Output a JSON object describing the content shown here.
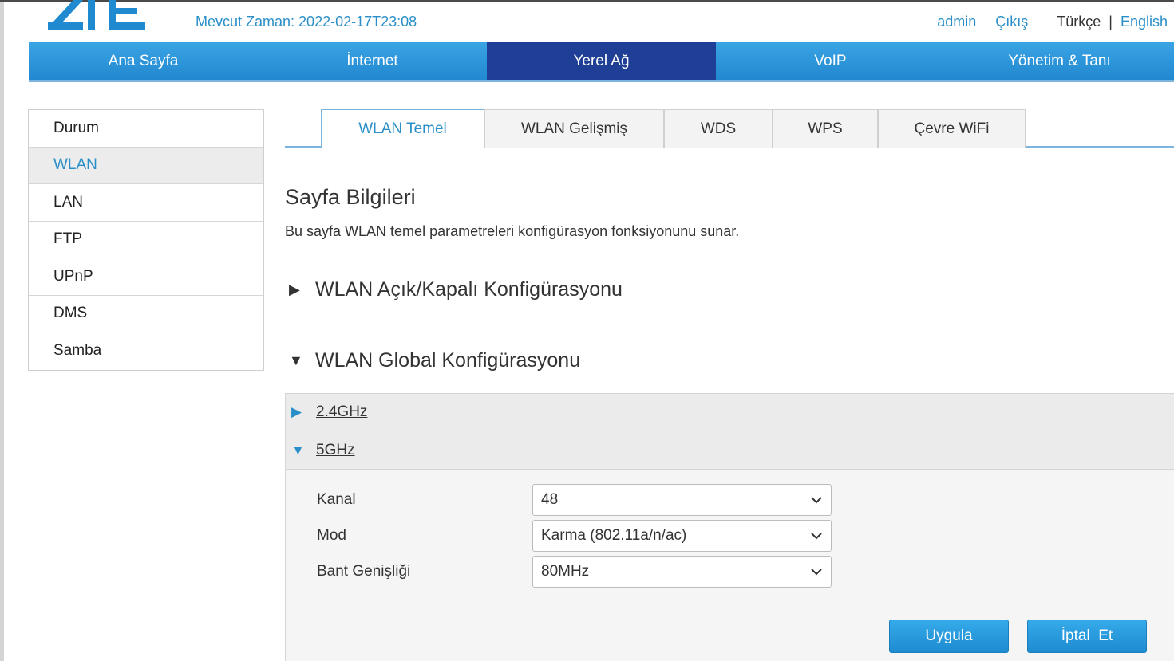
{
  "header": {
    "brand": "ZTE",
    "current_time": "Mevcut Zaman: 2022-02-17T23:08",
    "user": "admin",
    "logout": "Çıkış",
    "lang_current": "Türkçe",
    "lang_separator": "|",
    "lang_other": "English"
  },
  "topnav": {
    "items": [
      "Ana Sayfa",
      "İnternet",
      "Yerel Ağ",
      "VoIP",
      "Yönetim & Tanı"
    ],
    "active": "Yerel Ağ"
  },
  "sidebar": {
    "items": [
      "Durum",
      "WLAN",
      "LAN",
      "FTP",
      "UPnP",
      "DMS",
      "Samba"
    ],
    "active": "WLAN"
  },
  "tabs": {
    "items": [
      "WLAN Temel",
      "WLAN Gelişmiş",
      "WDS",
      "WPS",
      "Çevre WiFi"
    ],
    "active": "WLAN Temel"
  },
  "page": {
    "title": "Sayfa Bilgileri",
    "description": "Bu sayfa WLAN temel parametreleri konfigürasyon fonksiyonunu sunar."
  },
  "sections": {
    "onoff": {
      "title": "WLAN Açık/Kapalı Konfigürasyonu",
      "expanded": false
    },
    "global": {
      "title": "WLAN Global Konfigürasyonu",
      "expanded": true
    }
  },
  "bands": {
    "b24": {
      "label": "2.4GHz",
      "expanded": false
    },
    "b5": {
      "label": "5GHz",
      "expanded": true
    }
  },
  "form": {
    "channel": {
      "label": "Kanal",
      "value": "48"
    },
    "mode": {
      "label": "Mod",
      "value": "Karma (802.11a/n/ac)"
    },
    "bandwidth": {
      "label": "Bant Genişliği",
      "value": "80MHz"
    }
  },
  "buttons": {
    "apply": "Uygula",
    "cancel": "İptal  Et"
  },
  "colors": {
    "accent": "#2a8fc8",
    "nav_active": "#1e3f95",
    "nav_bg": "#2288d0"
  },
  "icons": {
    "collapsed": "triangle-right-icon",
    "expanded": "triangle-down-icon",
    "select": "chevron-down-icon"
  }
}
